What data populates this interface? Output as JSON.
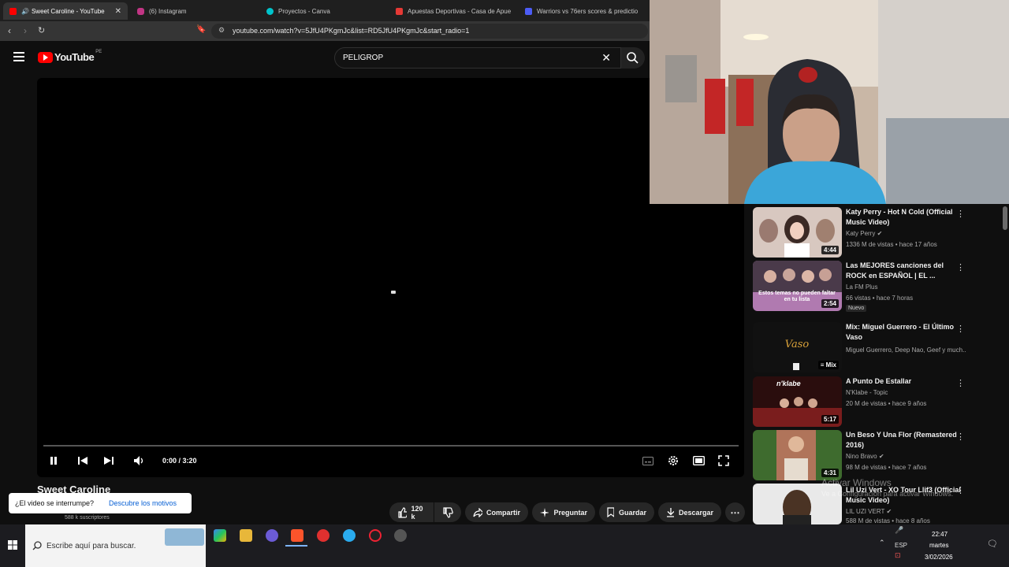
{
  "browser": {
    "tabs": [
      {
        "label": "Sweet Caroline - YouTube",
        "icon": "youtube-icon",
        "color": "#ff0000"
      },
      {
        "label": "(6) Instagram",
        "icon": "instagram-icon",
        "color": "#c13584"
      },
      {
        "label": "Proyectos - Canva",
        "icon": "canva-icon",
        "color": "#00c4cc"
      },
      {
        "label": "Apuestas Deportivas - Casa de Apue",
        "icon": "betting-icon",
        "color": "#e53935"
      },
      {
        "label": "Warriors vs 76ers scores & predictio",
        "icon": "news-icon",
        "color": "#4c5cf5"
      }
    ],
    "url": "youtube.com/watch?v=5JfU4PKgmJc&list=RD5JfU4PKgmJc&start_radio=1"
  },
  "youtube": {
    "logo_text": "YouTube",
    "region": "PE",
    "search_value": "PELIGROP",
    "player": {
      "time": "0:00 / 3:20",
      "progress": 0
    },
    "video_title": "Sweet Caroline",
    "subscribers": "588 k suscriptores",
    "actions": {
      "likes": "120 k",
      "share": "Compartir",
      "ask": "Preguntar",
      "save": "Guardar",
      "download": "Descargar"
    },
    "tooltip": {
      "question": "¿El video se interrumpe?",
      "link": "Descubre los motivos"
    },
    "recommendations": [
      {
        "title": "Katy Perry - Hot N Cold (Official Music Video)",
        "channel": "Katy Perry",
        "stats": "1336 M de vistas • hace 17 años",
        "duration": "4:44",
        "verified": true
      },
      {
        "title": "Las MEJORES canciones del ROCK en ESPAÑOL | EL ...",
        "channel": "La FM Plus",
        "stats": "66 vistas • hace 7 horas",
        "duration": "2:54",
        "badge": "Nuevo",
        "thumb_text": "Estos temas no pueden faltar en tu lista"
      },
      {
        "title": "Mix: Miguel Guerrero - El Último Vaso",
        "channel": "Miguel Guerrero, Deep Nao, Geef y much...",
        "duration": "Mix"
      },
      {
        "title": "A Punto De Estallar",
        "channel": "N'Klabe - Topic",
        "stats": "20 M de vistas • hace 9 años",
        "duration": "5:17",
        "thumb_text": "n'klabe"
      },
      {
        "title": "Un Beso Y Una Flor (Remastered 2016)",
        "channel": "Nino Bravo",
        "stats": "98 M de vistas • hace 7 años",
        "duration": "4:31",
        "verified": true
      },
      {
        "title": "Lil Uzi Vert - XO Tour Llif3 (Official Music Video)",
        "channel": "LIL UZI VERT",
        "stats": "588 M de vistas • hace 8 años",
        "verified": true
      }
    ]
  },
  "watermark": {
    "line1": "Activar Windows",
    "line2": "Ve a Configuración para activar Windows."
  },
  "taskbar": {
    "search_placeholder": "Escribe aquí para buscar.",
    "language": "ESP",
    "time": "22:47",
    "day": "martes",
    "date": "3/02/2026"
  }
}
